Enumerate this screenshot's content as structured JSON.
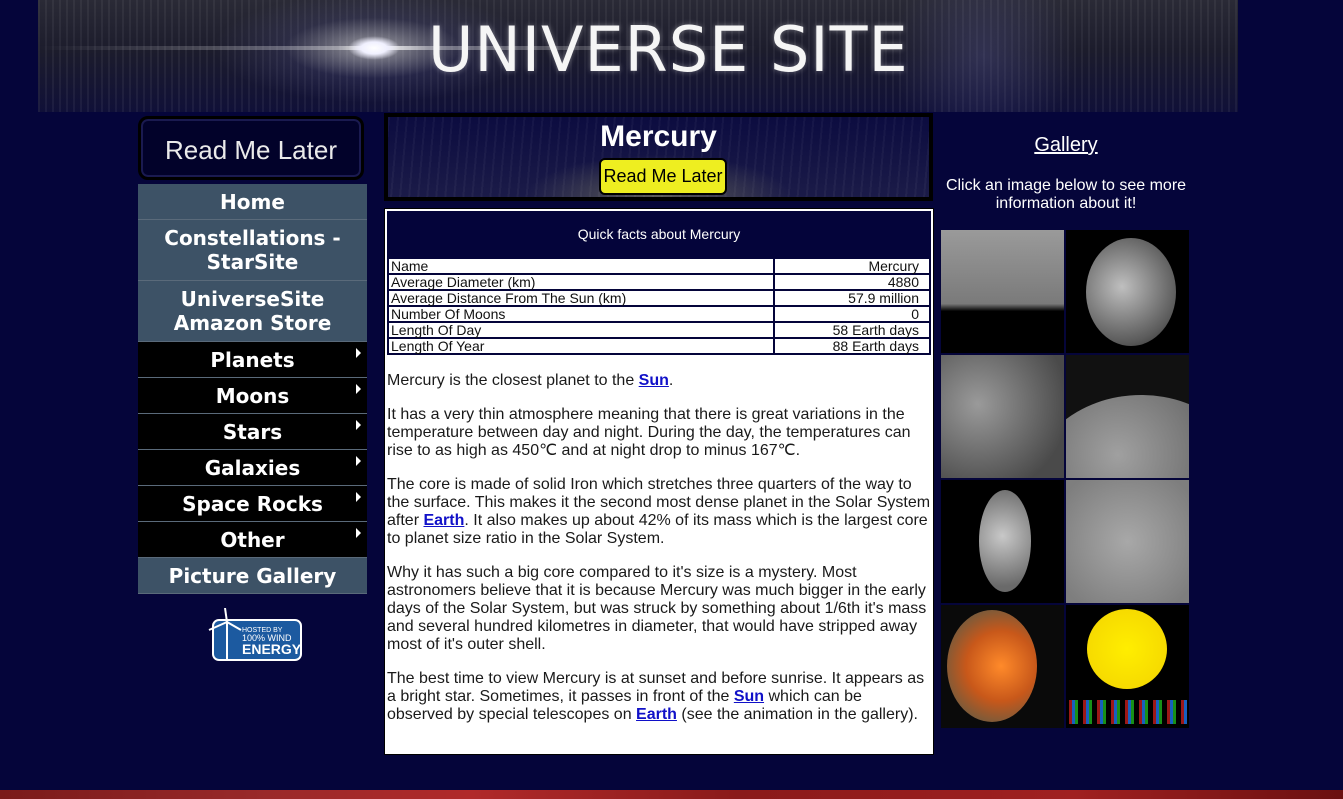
{
  "site": {
    "title": "UNIVERSE SITE"
  },
  "sidebar": {
    "read_me_later_logo": "Read Me Later",
    "nav": [
      {
        "label": "Home",
        "has_submenu": false
      },
      {
        "label": "Constellations - StarSite",
        "has_submenu": false
      },
      {
        "label": "UniverseSite Amazon Store",
        "has_submenu": false
      },
      {
        "label": "Planets",
        "has_submenu": true
      },
      {
        "label": "Moons",
        "has_submenu": true
      },
      {
        "label": "Stars",
        "has_submenu": true
      },
      {
        "label": "Galaxies",
        "has_submenu": true
      },
      {
        "label": "Space Rocks",
        "has_submenu": true
      },
      {
        "label": "Other",
        "has_submenu": true
      },
      {
        "label": "Picture Gallery",
        "has_submenu": false
      }
    ],
    "badge": {
      "line1": "HOSTED BY",
      "line2": "100% WIND",
      "line3": "ENERGY"
    }
  },
  "main": {
    "page_title": "Mercury",
    "read_me_later_button": "Read Me Later",
    "facts": {
      "heading": "Quick facts about Mercury",
      "rows": [
        {
          "label": "Name",
          "value": "Mercury"
        },
        {
          "label": "Average Diameter (km)",
          "value": "4880"
        },
        {
          "label": "Average Distance From The Sun (km)",
          "value": "57.9 million"
        },
        {
          "label": "Number Of Moons",
          "value": "0"
        },
        {
          "label": "Length Of Day",
          "value": "58 Earth days"
        },
        {
          "label": "Length Of Year",
          "value": "88 Earth days"
        }
      ]
    },
    "paragraphs": {
      "p1": {
        "a": "Mercury is the closest planet to the ",
        "link": "Sun",
        "b": "."
      },
      "p2": "It has a very thin atmosphere meaning that there is great variations in the temperature between day and night. During the day, the temperatures can rise to as high as 450℃ and at night drop to minus 167℃.",
      "p3": {
        "a": "The core is made of solid Iron which stretches three quarters of the way to the surface. This makes it the second most dense planet in the Solar System after ",
        "link": "Earth",
        "b": ". It also makes up about 42% of its mass which is the largest core to planet size ratio in the Solar System."
      },
      "p4": "Why it has such a big core compared to it's size is a mystery. Most astronomers believe that it is because Mercury was much bigger in the early days of the Solar System, but was struck by something about 1/6th it's mass and several hundred kilometres in diameter, that would have stripped away most of it's outer shell.",
      "p5": {
        "a": "The best time to view Mercury is at sunset and before sunrise. It appears as a bright star. Sometimes, it passes in front of the ",
        "link1": "Sun",
        "b": " which can be observed by special telescopes on ",
        "link2": "Earth",
        "c": " (see the animation in the gallery)."
      }
    }
  },
  "gallery": {
    "title": "Gallery",
    "intro": "Click an image below to see more information about it!",
    "thumbnails": 8
  }
}
